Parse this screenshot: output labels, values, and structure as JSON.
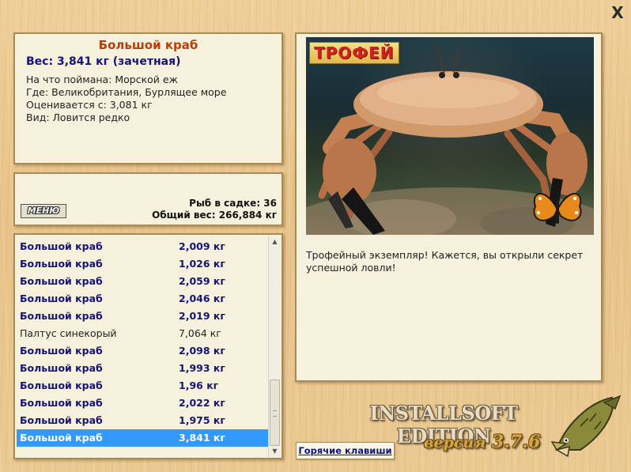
{
  "window": {
    "close_symbol": "X"
  },
  "info": {
    "title": "Большой краб",
    "weight_line": "Вес: 3,841 кг (зачетная)",
    "lines": [
      "На что поймана: Морской еж",
      "Где: Великобритания, Бурлящее море",
      "Оценивается с: 3,081 кг",
      "Вид: Ловится редко"
    ]
  },
  "stats": {
    "menu_label": "МЕНЮ",
    "fish_in_cage": "Рыб в садке: 36",
    "total_weight": "Общий вес: 266,884 кг"
  },
  "catch_list": [
    {
      "name": "Большой краб",
      "weight": "2,009 кг",
      "trophy": true,
      "selected": false
    },
    {
      "name": "Большой краб",
      "weight": "1,026 кг",
      "trophy": true,
      "selected": false
    },
    {
      "name": "Большой краб",
      "weight": "2,059 кг",
      "trophy": true,
      "selected": false
    },
    {
      "name": "Большой краб",
      "weight": "2,046 кг",
      "trophy": true,
      "selected": false
    },
    {
      "name": "Большой краб",
      "weight": "2,019 кг",
      "trophy": true,
      "selected": false
    },
    {
      "name": "Палтус синекорый",
      "weight": "7,064 кг",
      "trophy": false,
      "selected": false
    },
    {
      "name": "Большой краб",
      "weight": "2,098 кг",
      "trophy": true,
      "selected": false
    },
    {
      "name": "Большой краб",
      "weight": "1,993 кг",
      "trophy": true,
      "selected": false
    },
    {
      "name": "Большой краб",
      "weight": "1,96 кг",
      "trophy": true,
      "selected": false
    },
    {
      "name": "Большой краб",
      "weight": "2,022 кг",
      "trophy": true,
      "selected": false
    },
    {
      "name": "Большой краб",
      "weight": "1,975 кг",
      "trophy": true,
      "selected": false
    },
    {
      "name": "Большой краб",
      "weight": "3,841 кг",
      "trophy": true,
      "selected": true
    }
  ],
  "trophy": {
    "badge": "ТРОФЕЙ",
    "message": "Трофейный экземпляр! Кажется, вы открыли секрет успешной ловли!"
  },
  "hotkeys_label": "Горячие клавиши",
  "branding": {
    "edition": "INSTALLSOFT EDITION",
    "version_word": "версия",
    "version_number": "3.7.6"
  },
  "colors": {
    "trophy_text": "#14147a",
    "title": "#b5400c",
    "selection": "#3399ff",
    "background": "#e8c38a"
  }
}
